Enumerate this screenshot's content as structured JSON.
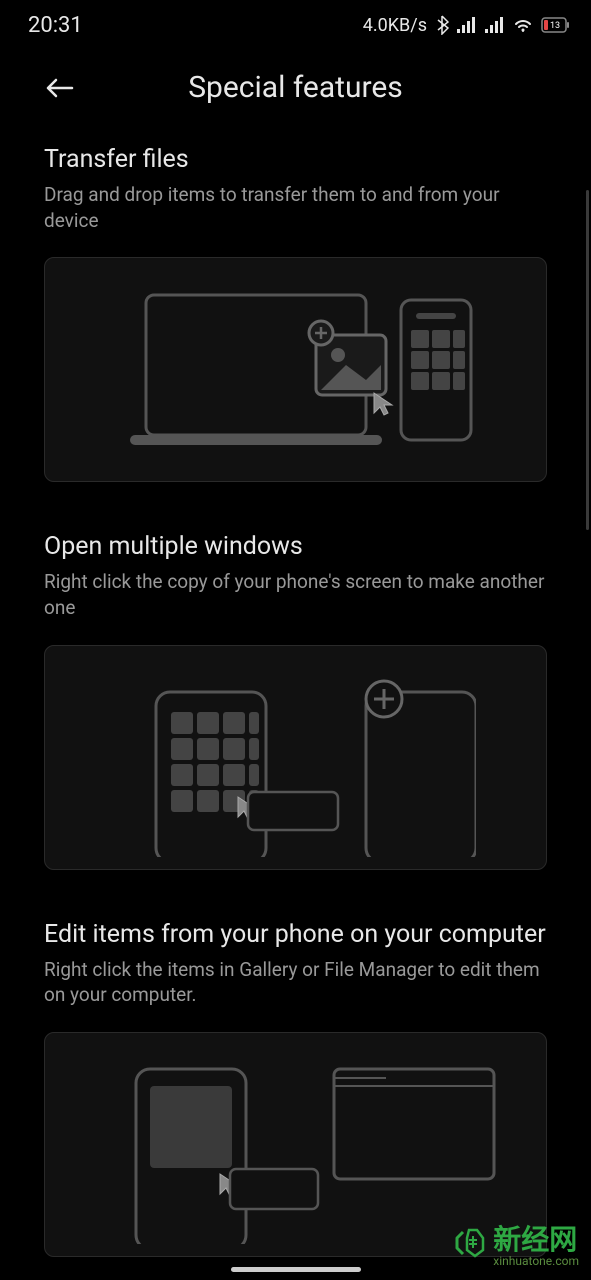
{
  "status_bar": {
    "time": "20:31",
    "network_speed": "4.0KB/s",
    "battery_level": "13"
  },
  "header": {
    "title": "Special features"
  },
  "features": [
    {
      "title": "Transfer files",
      "description": "Drag and drop items to transfer them to and from your device"
    },
    {
      "title": "Open multiple windows",
      "description": "Right click the copy of your phone's screen to make another one"
    },
    {
      "title": "Edit items from your phone on your computer",
      "description": "Right click the items in Gallery or File Manager to edit them on your computer."
    }
  ],
  "watermark": {
    "main": "新经网",
    "sub": "xinhuatone.com"
  }
}
